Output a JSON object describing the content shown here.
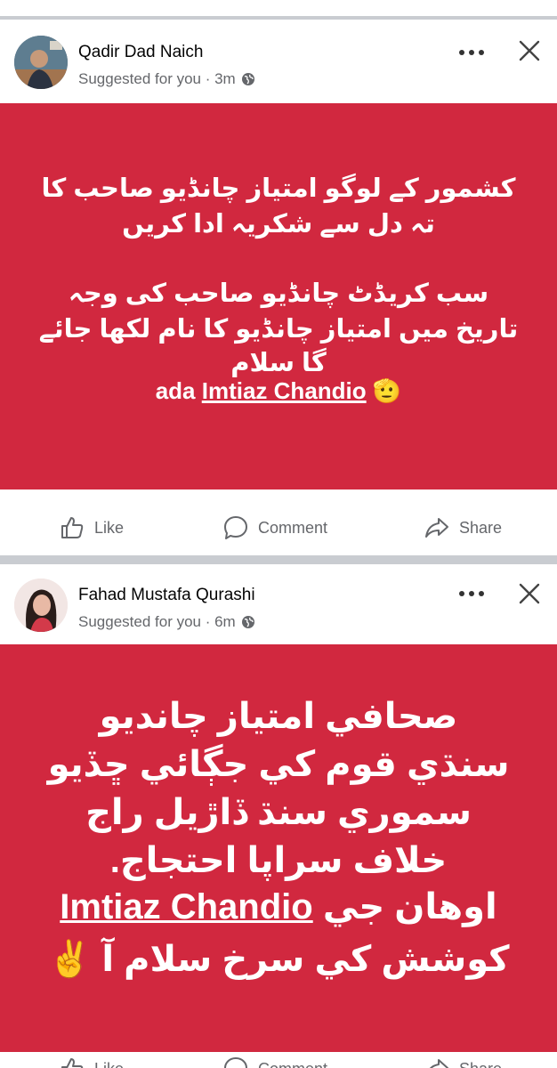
{
  "posts": [
    {
      "author": "Qadir Dad Naich",
      "meta": "Suggested for you · 3m",
      "card_lines": [
        "کشمور کے لوگو امتیاز چانڈیو صاحب کا",
        "تہ دل سے شکریہ ادا کریں",
        "سب کریڈٹ چانڈیو صاحب کی وجہ",
        "تاریخ میں امتیاز چانڈیو کا نام لکھا جائے",
        "گا سلام"
      ],
      "card_last_prefix": "ada ",
      "card_mention": "Imtiaz Chandio",
      "card_emoji": "🫡",
      "card_color": "#d1283f"
    },
    {
      "author": "Fahad Mustafa Qurashi",
      "meta": "Suggested for you · 6m",
      "card_lines": [
        "صحافي امتياز چانديو",
        "سنڌي قوم کي جڳائي ڇڏيو",
        "سموري سنڌ ڏاڙيل راج",
        "خلاف سراپا احتجاج.",
        "کوشش کي سرخ سلام آ ✌️"
      ],
      "card_mention_prefix": "اوهان جي",
      "card_mention": "Imtiaz Chandio",
      "card_color": "#d1283f"
    }
  ],
  "actions": {
    "like": "Like",
    "comment": "Comment",
    "share": "Share"
  },
  "icons": [
    "more-icon",
    "close-icon",
    "globe-icon",
    "like-icon",
    "comment-icon",
    "share-icon"
  ]
}
